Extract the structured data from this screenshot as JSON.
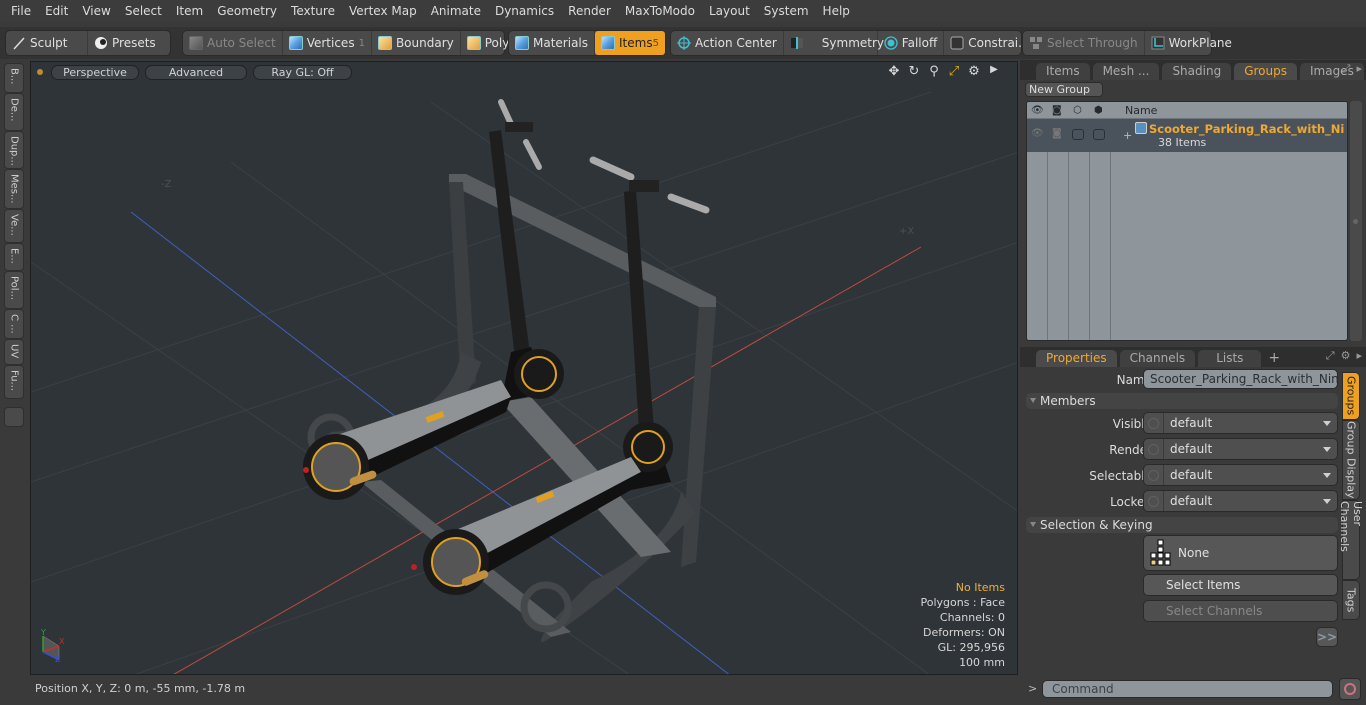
{
  "menubar": {
    "items": [
      "File",
      "Edit",
      "View",
      "Select",
      "Item",
      "Geometry",
      "Texture",
      "Vertex Map",
      "Animate",
      "Dynamics",
      "Render",
      "MaxToModo",
      "Layout",
      "System",
      "Help"
    ]
  },
  "toolbar": {
    "sculpt": "Sculpt",
    "presets": "Presets",
    "auto_select": "Auto Select",
    "vertices": "Vertices",
    "vertices_count": "1",
    "boundary": "Boundary",
    "polygons": "Polygons",
    "materials": "Materials",
    "items": "Items",
    "items_count": "5",
    "action_center": "Action Center",
    "symmetry": "Symmetry",
    "falloff": "Falloff",
    "constraints": "Constrai...",
    "select_through": "Select Through",
    "workplane": "WorkPlane",
    "accent_color": "#f0a020"
  },
  "left_strip": {
    "tabs": [
      "B...",
      "De...",
      "Dup...",
      "Mes...",
      "Ve...",
      "E...",
      "Pol...",
      "C ...",
      "UV",
      "Fu..."
    ]
  },
  "viewport": {
    "view_mode": "Perspective",
    "shading": "Advanced",
    "raygl": "Ray GL: Off",
    "tools": [
      "move-icon",
      "rotate-icon",
      "zoom-icon",
      "fit-icon",
      "gear-icon",
      "play-icon"
    ],
    "axis_labels": {
      "neg_z": "-Z",
      "pos_x": "+X"
    },
    "info": {
      "selection": "No Items",
      "polygons": "Polygons : Face",
      "channels": "Channels: 0",
      "deformers": "Deformers: ON",
      "gl": "GL: 295,956",
      "scale": "100 mm"
    }
  },
  "statusbar": {
    "position": "Position X, Y, Z:   0 m, -55 mm, -1.78 m"
  },
  "groups_panel": {
    "tabs": [
      "Items",
      "Mesh ...",
      "Shading",
      "Groups",
      "Images"
    ],
    "active_tab": "Groups",
    "new_group": "New Group",
    "column_name": "Name",
    "groups": [
      {
        "name": "Scooter_Parking_Rack_with_Ni ...",
        "count": "38 Items"
      }
    ]
  },
  "properties_panel": {
    "tabs": [
      "Properties",
      "Channels",
      "Lists"
    ],
    "active_tab": "Properties",
    "name_label": "Name",
    "name_value": "Scooter_Parking_Rack_with_Ninebot_",
    "members_section": "Members",
    "members": [
      {
        "label": "Visible",
        "value": "default"
      },
      {
        "label": "Render",
        "value": "default"
      },
      {
        "label": "Selectable",
        "value": "default"
      },
      {
        "label": "Locked",
        "value": "default"
      }
    ],
    "selection_section": "Selection & Keying",
    "selection_mode": "None",
    "select_items": "Select Items",
    "select_channels": "Select Channels",
    "more": ">>",
    "side_tabs": [
      "Groups",
      "Group Display",
      "User Channels",
      "Tags"
    ],
    "active_side_tab": "Groups"
  },
  "command": {
    "prompt": ">",
    "placeholder": "Command"
  }
}
